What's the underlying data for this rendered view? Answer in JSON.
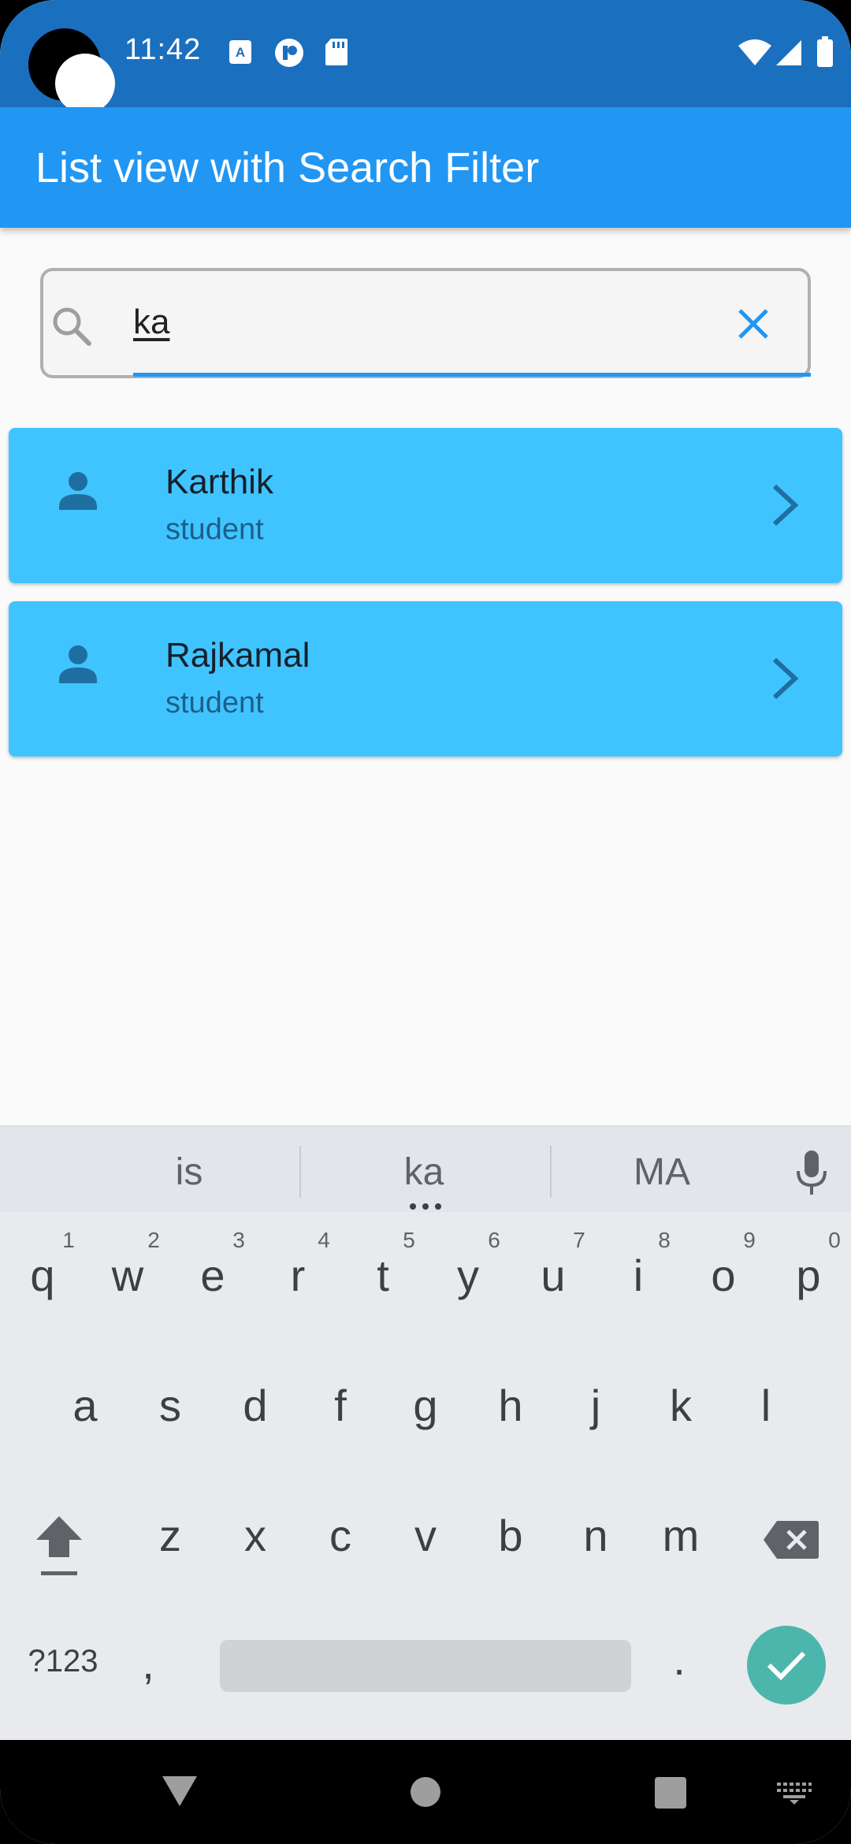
{
  "status_bar": {
    "time": "11:42",
    "left_icons": [
      "text-recognition-icon",
      "app-notification-icon",
      "sd-card-icon"
    ],
    "right_icons": [
      "wifi-icon",
      "signal-icon",
      "battery-icon"
    ]
  },
  "app_bar": {
    "title": "List view with Search Filter"
  },
  "search": {
    "value": "ka",
    "search_icon": "search-icon",
    "clear_icon": "close-icon",
    "accent": "#2196f3"
  },
  "list": {
    "items": [
      {
        "title": "Karthik",
        "subtitle": "student"
      },
      {
        "title": "Rajkamal",
        "subtitle": "student"
      }
    ],
    "item_color": "#40c4ff"
  },
  "keyboard": {
    "suggestions": [
      "is",
      "ka",
      "MA"
    ],
    "row1": [
      "q",
      "w",
      "e",
      "r",
      "t",
      "y",
      "u",
      "i",
      "o",
      "p"
    ],
    "row1_hints": [
      "1",
      "2",
      "3",
      "4",
      "5",
      "6",
      "7",
      "8",
      "9",
      "0"
    ],
    "row2": [
      "a",
      "s",
      "d",
      "f",
      "g",
      "h",
      "j",
      "k",
      "l"
    ],
    "row3": [
      "z",
      "x",
      "c",
      "v",
      "b",
      "n",
      "m"
    ],
    "symbols_label": "?123",
    "comma_label": ",",
    "period_label": ".",
    "enter_color": "#4db6ac"
  },
  "nav_bar": {
    "icons": [
      "back-icon",
      "home-icon",
      "recents-icon",
      "keyboard-switch-icon"
    ]
  }
}
